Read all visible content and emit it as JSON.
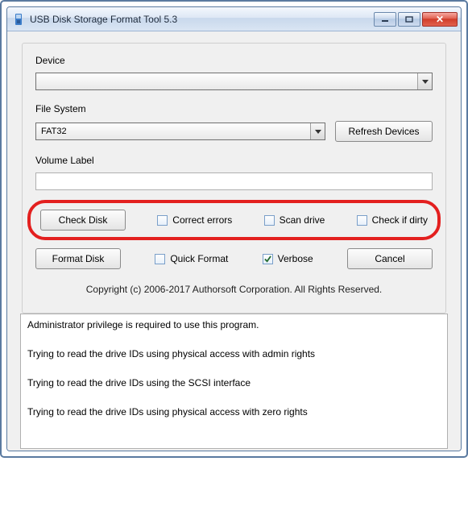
{
  "window": {
    "title": "USB Disk Storage Format Tool 5.3"
  },
  "form": {
    "device_label": "Device",
    "device_value": "",
    "filesystem_label": "File System",
    "filesystem_value": "FAT32",
    "refresh_label": "Refresh Devices",
    "volume_label": "Volume Label",
    "volume_value": ""
  },
  "check_row": {
    "check_disk_btn": "Check Disk",
    "correct_errors": "Correct errors",
    "scan_drive": "Scan drive",
    "check_if_dirty": "Check if dirty"
  },
  "format_row": {
    "format_disk_btn": "Format Disk",
    "quick_format": "Quick Format",
    "verbose": "Verbose",
    "cancel_btn": "Cancel"
  },
  "copyright": "Copyright (c) 2006-2017 Authorsoft Corporation. All Rights Reserved.",
  "log": [
    "Administrator privilege is required to use this program.",
    "Trying to read the drive IDs using physical access with admin rights",
    "Trying to read the drive IDs using the SCSI interface",
    "Trying to read the drive IDs using physical access with zero rights"
  ]
}
